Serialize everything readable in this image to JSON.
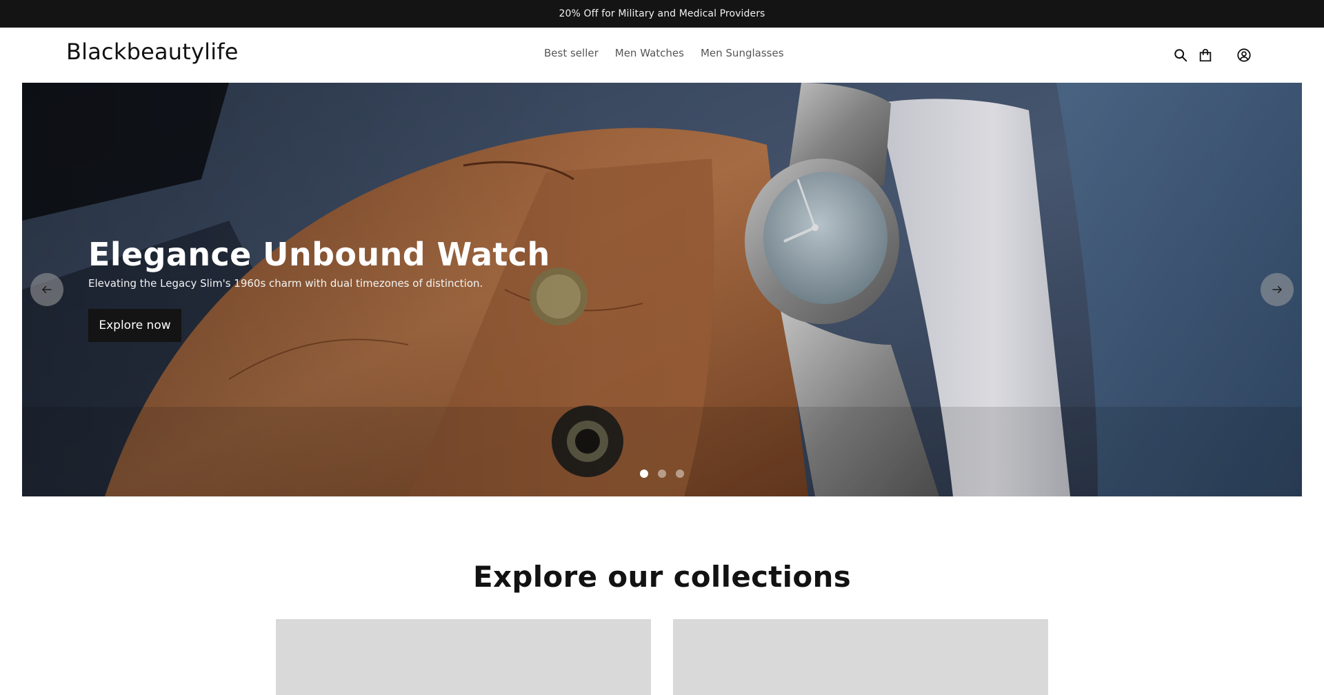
{
  "announcement": {
    "text": "20% Off for Military and Medical Providers"
  },
  "header": {
    "logo": "Blackbeautylife",
    "nav": [
      {
        "label": "Best seller"
      },
      {
        "label": "Men Watches"
      },
      {
        "label": "Men Sunglasses"
      }
    ],
    "icons": [
      "search-icon",
      "cart-icon",
      "account-icon"
    ]
  },
  "hero": {
    "title": "Elegance Unbound Watch",
    "subtitle": "Elevating the Legacy Slim's 1960s charm with dual timezones of distinction.",
    "button_label": "Explore now",
    "slides_count": 3,
    "active_slide": 1
  },
  "collections": {
    "title": "Explore our collections",
    "card_color": "#d9d9d9"
  },
  "colors": {
    "announcement_bg": "#141414",
    "button_bg": "#141414",
    "text": "#121212"
  }
}
